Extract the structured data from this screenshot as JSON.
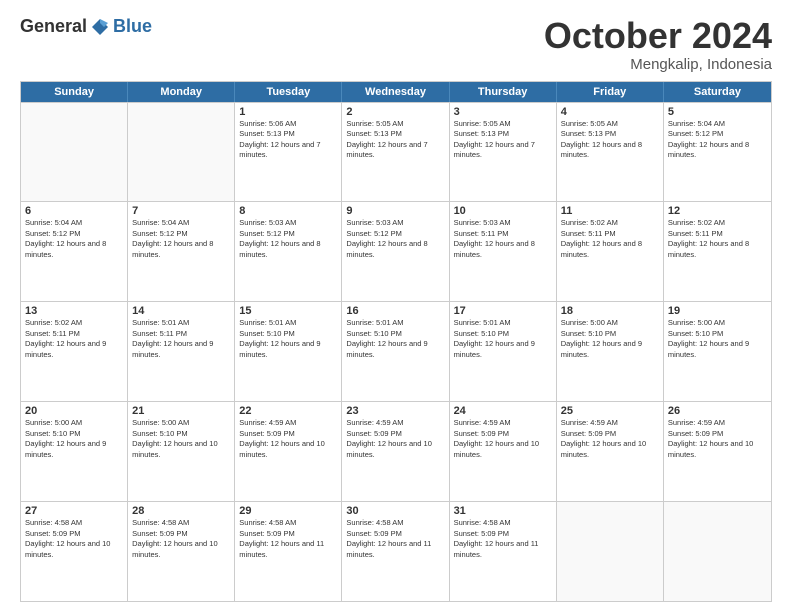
{
  "logo": {
    "general": "General",
    "blue": "Blue"
  },
  "header": {
    "month": "October 2024",
    "location": "Mengkalip, Indonesia"
  },
  "weekdays": [
    "Sunday",
    "Monday",
    "Tuesday",
    "Wednesday",
    "Thursday",
    "Friday",
    "Saturday"
  ],
  "rows": [
    [
      {
        "day": "",
        "empty": true
      },
      {
        "day": "",
        "empty": true
      },
      {
        "day": "1",
        "sunrise": "5:06 AM",
        "sunset": "5:13 PM",
        "daylight": "12 hours and 7 minutes."
      },
      {
        "day": "2",
        "sunrise": "5:05 AM",
        "sunset": "5:13 PM",
        "daylight": "12 hours and 7 minutes."
      },
      {
        "day": "3",
        "sunrise": "5:05 AM",
        "sunset": "5:13 PM",
        "daylight": "12 hours and 7 minutes."
      },
      {
        "day": "4",
        "sunrise": "5:05 AM",
        "sunset": "5:13 PM",
        "daylight": "12 hours and 8 minutes."
      },
      {
        "day": "5",
        "sunrise": "5:04 AM",
        "sunset": "5:12 PM",
        "daylight": "12 hours and 8 minutes."
      }
    ],
    [
      {
        "day": "6",
        "sunrise": "5:04 AM",
        "sunset": "5:12 PM",
        "daylight": "12 hours and 8 minutes."
      },
      {
        "day": "7",
        "sunrise": "5:04 AM",
        "sunset": "5:12 PM",
        "daylight": "12 hours and 8 minutes."
      },
      {
        "day": "8",
        "sunrise": "5:03 AM",
        "sunset": "5:12 PM",
        "daylight": "12 hours and 8 minutes."
      },
      {
        "day": "9",
        "sunrise": "5:03 AM",
        "sunset": "5:12 PM",
        "daylight": "12 hours and 8 minutes."
      },
      {
        "day": "10",
        "sunrise": "5:03 AM",
        "sunset": "5:11 PM",
        "daylight": "12 hours and 8 minutes."
      },
      {
        "day": "11",
        "sunrise": "5:02 AM",
        "sunset": "5:11 PM",
        "daylight": "12 hours and 8 minutes."
      },
      {
        "day": "12",
        "sunrise": "5:02 AM",
        "sunset": "5:11 PM",
        "daylight": "12 hours and 8 minutes."
      }
    ],
    [
      {
        "day": "13",
        "sunrise": "5:02 AM",
        "sunset": "5:11 PM",
        "daylight": "12 hours and 9 minutes."
      },
      {
        "day": "14",
        "sunrise": "5:01 AM",
        "sunset": "5:11 PM",
        "daylight": "12 hours and 9 minutes."
      },
      {
        "day": "15",
        "sunrise": "5:01 AM",
        "sunset": "5:10 PM",
        "daylight": "12 hours and 9 minutes."
      },
      {
        "day": "16",
        "sunrise": "5:01 AM",
        "sunset": "5:10 PM",
        "daylight": "12 hours and 9 minutes."
      },
      {
        "day": "17",
        "sunrise": "5:01 AM",
        "sunset": "5:10 PM",
        "daylight": "12 hours and 9 minutes."
      },
      {
        "day": "18",
        "sunrise": "5:00 AM",
        "sunset": "5:10 PM",
        "daylight": "12 hours and 9 minutes."
      },
      {
        "day": "19",
        "sunrise": "5:00 AM",
        "sunset": "5:10 PM",
        "daylight": "12 hours and 9 minutes."
      }
    ],
    [
      {
        "day": "20",
        "sunrise": "5:00 AM",
        "sunset": "5:10 PM",
        "daylight": "12 hours and 9 minutes."
      },
      {
        "day": "21",
        "sunrise": "5:00 AM",
        "sunset": "5:10 PM",
        "daylight": "12 hours and 10 minutes."
      },
      {
        "day": "22",
        "sunrise": "4:59 AM",
        "sunset": "5:09 PM",
        "daylight": "12 hours and 10 minutes."
      },
      {
        "day": "23",
        "sunrise": "4:59 AM",
        "sunset": "5:09 PM",
        "daylight": "12 hours and 10 minutes."
      },
      {
        "day": "24",
        "sunrise": "4:59 AM",
        "sunset": "5:09 PM",
        "daylight": "12 hours and 10 minutes."
      },
      {
        "day": "25",
        "sunrise": "4:59 AM",
        "sunset": "5:09 PM",
        "daylight": "12 hours and 10 minutes."
      },
      {
        "day": "26",
        "sunrise": "4:59 AM",
        "sunset": "5:09 PM",
        "daylight": "12 hours and 10 minutes."
      }
    ],
    [
      {
        "day": "27",
        "sunrise": "4:58 AM",
        "sunset": "5:09 PM",
        "daylight": "12 hours and 10 minutes."
      },
      {
        "day": "28",
        "sunrise": "4:58 AM",
        "sunset": "5:09 PM",
        "daylight": "12 hours and 10 minutes."
      },
      {
        "day": "29",
        "sunrise": "4:58 AM",
        "sunset": "5:09 PM",
        "daylight": "12 hours and 11 minutes."
      },
      {
        "day": "30",
        "sunrise": "4:58 AM",
        "sunset": "5:09 PM",
        "daylight": "12 hours and 11 minutes."
      },
      {
        "day": "31",
        "sunrise": "4:58 AM",
        "sunset": "5:09 PM",
        "daylight": "12 hours and 11 minutes."
      },
      {
        "day": "",
        "empty": true
      },
      {
        "day": "",
        "empty": true
      }
    ]
  ]
}
